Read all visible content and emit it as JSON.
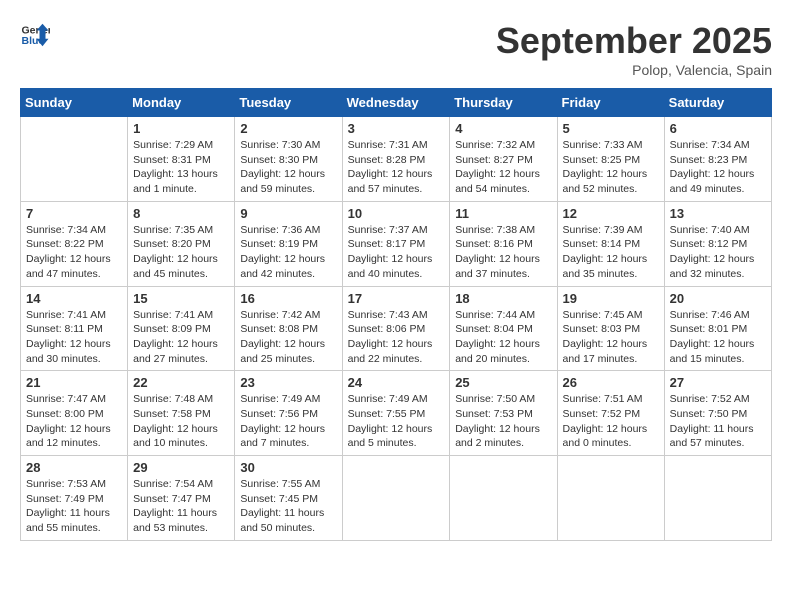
{
  "header": {
    "logo_line1": "General",
    "logo_line2": "Blue",
    "month_title": "September 2025",
    "location": "Polop, Valencia, Spain"
  },
  "weekdays": [
    "Sunday",
    "Monday",
    "Tuesday",
    "Wednesday",
    "Thursday",
    "Friday",
    "Saturday"
  ],
  "weeks": [
    [
      {
        "day": "",
        "info": ""
      },
      {
        "day": "1",
        "info": "Sunrise: 7:29 AM\nSunset: 8:31 PM\nDaylight: 13 hours\nand 1 minute."
      },
      {
        "day": "2",
        "info": "Sunrise: 7:30 AM\nSunset: 8:30 PM\nDaylight: 12 hours\nand 59 minutes."
      },
      {
        "day": "3",
        "info": "Sunrise: 7:31 AM\nSunset: 8:28 PM\nDaylight: 12 hours\nand 57 minutes."
      },
      {
        "day": "4",
        "info": "Sunrise: 7:32 AM\nSunset: 8:27 PM\nDaylight: 12 hours\nand 54 minutes."
      },
      {
        "day": "5",
        "info": "Sunrise: 7:33 AM\nSunset: 8:25 PM\nDaylight: 12 hours\nand 52 minutes."
      },
      {
        "day": "6",
        "info": "Sunrise: 7:34 AM\nSunset: 8:23 PM\nDaylight: 12 hours\nand 49 minutes."
      }
    ],
    [
      {
        "day": "7",
        "info": "Sunrise: 7:34 AM\nSunset: 8:22 PM\nDaylight: 12 hours\nand 47 minutes."
      },
      {
        "day": "8",
        "info": "Sunrise: 7:35 AM\nSunset: 8:20 PM\nDaylight: 12 hours\nand 45 minutes."
      },
      {
        "day": "9",
        "info": "Sunrise: 7:36 AM\nSunset: 8:19 PM\nDaylight: 12 hours\nand 42 minutes."
      },
      {
        "day": "10",
        "info": "Sunrise: 7:37 AM\nSunset: 8:17 PM\nDaylight: 12 hours\nand 40 minutes."
      },
      {
        "day": "11",
        "info": "Sunrise: 7:38 AM\nSunset: 8:16 PM\nDaylight: 12 hours\nand 37 minutes."
      },
      {
        "day": "12",
        "info": "Sunrise: 7:39 AM\nSunset: 8:14 PM\nDaylight: 12 hours\nand 35 minutes."
      },
      {
        "day": "13",
        "info": "Sunrise: 7:40 AM\nSunset: 8:12 PM\nDaylight: 12 hours\nand 32 minutes."
      }
    ],
    [
      {
        "day": "14",
        "info": "Sunrise: 7:41 AM\nSunset: 8:11 PM\nDaylight: 12 hours\nand 30 minutes."
      },
      {
        "day": "15",
        "info": "Sunrise: 7:41 AM\nSunset: 8:09 PM\nDaylight: 12 hours\nand 27 minutes."
      },
      {
        "day": "16",
        "info": "Sunrise: 7:42 AM\nSunset: 8:08 PM\nDaylight: 12 hours\nand 25 minutes."
      },
      {
        "day": "17",
        "info": "Sunrise: 7:43 AM\nSunset: 8:06 PM\nDaylight: 12 hours\nand 22 minutes."
      },
      {
        "day": "18",
        "info": "Sunrise: 7:44 AM\nSunset: 8:04 PM\nDaylight: 12 hours\nand 20 minutes."
      },
      {
        "day": "19",
        "info": "Sunrise: 7:45 AM\nSunset: 8:03 PM\nDaylight: 12 hours\nand 17 minutes."
      },
      {
        "day": "20",
        "info": "Sunrise: 7:46 AM\nSunset: 8:01 PM\nDaylight: 12 hours\nand 15 minutes."
      }
    ],
    [
      {
        "day": "21",
        "info": "Sunrise: 7:47 AM\nSunset: 8:00 PM\nDaylight: 12 hours\nand 12 minutes."
      },
      {
        "day": "22",
        "info": "Sunrise: 7:48 AM\nSunset: 7:58 PM\nDaylight: 12 hours\nand 10 minutes."
      },
      {
        "day": "23",
        "info": "Sunrise: 7:49 AM\nSunset: 7:56 PM\nDaylight: 12 hours\nand 7 minutes."
      },
      {
        "day": "24",
        "info": "Sunrise: 7:49 AM\nSunset: 7:55 PM\nDaylight: 12 hours\nand 5 minutes."
      },
      {
        "day": "25",
        "info": "Sunrise: 7:50 AM\nSunset: 7:53 PM\nDaylight: 12 hours\nand 2 minutes."
      },
      {
        "day": "26",
        "info": "Sunrise: 7:51 AM\nSunset: 7:52 PM\nDaylight: 12 hours\nand 0 minutes."
      },
      {
        "day": "27",
        "info": "Sunrise: 7:52 AM\nSunset: 7:50 PM\nDaylight: 11 hours\nand 57 minutes."
      }
    ],
    [
      {
        "day": "28",
        "info": "Sunrise: 7:53 AM\nSunset: 7:49 PM\nDaylight: 11 hours\nand 55 minutes."
      },
      {
        "day": "29",
        "info": "Sunrise: 7:54 AM\nSunset: 7:47 PM\nDaylight: 11 hours\nand 53 minutes."
      },
      {
        "day": "30",
        "info": "Sunrise: 7:55 AM\nSunset: 7:45 PM\nDaylight: 11 hours\nand 50 minutes."
      },
      {
        "day": "",
        "info": ""
      },
      {
        "day": "",
        "info": ""
      },
      {
        "day": "",
        "info": ""
      },
      {
        "day": "",
        "info": ""
      }
    ]
  ]
}
